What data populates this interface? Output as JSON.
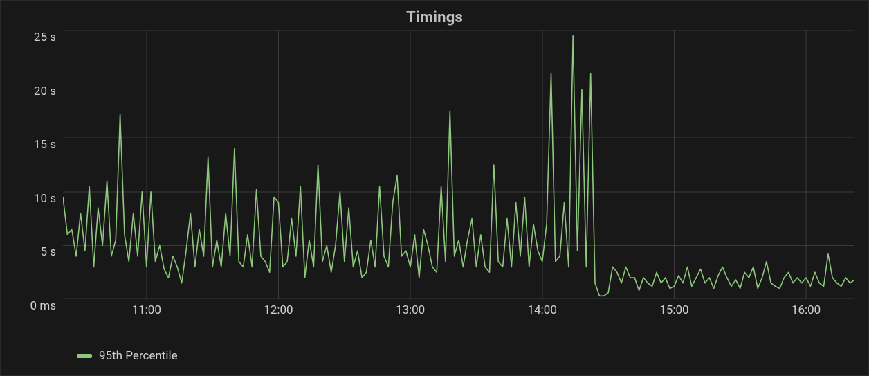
{
  "title": "Timings",
  "legend": {
    "series_label": "95th Percentile"
  },
  "colors": {
    "panel_bg": "#181818",
    "grid": "#3a3a3a",
    "line": "#8fc77e",
    "text": "#cfcfcf",
    "title": "#bfbfbf"
  },
  "y_axis": {
    "ticks": [
      {
        "value_sec": 0,
        "label": "0 ms"
      },
      {
        "value_sec": 5,
        "label": "5 s"
      },
      {
        "value_sec": 10,
        "label": "10 s"
      },
      {
        "value_sec": 15,
        "label": "15 s"
      },
      {
        "value_sec": 20,
        "label": "20 s"
      },
      {
        "value_sec": 25,
        "label": "25 s"
      }
    ],
    "ylim_sec": [
      0,
      25
    ]
  },
  "x_axis": {
    "ticks": [
      {
        "minute": 660,
        "label": "11:00"
      },
      {
        "minute": 720,
        "label": "12:00"
      },
      {
        "minute": 780,
        "label": "13:00"
      },
      {
        "minute": 840,
        "label": "14:00"
      },
      {
        "minute": 900,
        "label": "15:00"
      },
      {
        "minute": 960,
        "label": "16:00"
      }
    ],
    "xlim_minute": [
      622,
      982
    ]
  },
  "chart_data": {
    "type": "line",
    "title": "Timings",
    "xlabel": "",
    "ylabel": "",
    "x_unit": "minute_of_day",
    "y_unit": "seconds",
    "ylim": [
      0,
      25
    ],
    "xlim_minute": [
      622,
      982
    ],
    "x_tick_labels": [
      "11:00",
      "12:00",
      "13:00",
      "14:00",
      "15:00",
      "16:00"
    ],
    "y_tick_labels": [
      "0 ms",
      "5 s",
      "10 s",
      "15 s",
      "20 s",
      "25 s"
    ],
    "legend_position": "bottom-left",
    "grid": true,
    "series": [
      {
        "name": "95th Percentile",
        "color": "#8fc77e",
        "x": [
          622,
          624,
          626,
          628,
          630,
          632,
          634,
          636,
          638,
          640,
          642,
          644,
          646,
          648,
          650,
          652,
          654,
          656,
          658,
          660,
          662,
          664,
          666,
          668,
          670,
          672,
          674,
          676,
          678,
          680,
          682,
          684,
          686,
          688,
          690,
          692,
          694,
          696,
          698,
          700,
          702,
          704,
          706,
          708,
          710,
          712,
          714,
          716,
          718,
          720,
          722,
          724,
          726,
          728,
          730,
          732,
          734,
          736,
          738,
          740,
          742,
          744,
          746,
          748,
          750,
          752,
          754,
          756,
          758,
          760,
          762,
          764,
          766,
          768,
          770,
          772,
          774,
          776,
          778,
          780,
          782,
          784,
          786,
          788,
          790,
          792,
          794,
          796,
          798,
          800,
          802,
          804,
          806,
          808,
          810,
          812,
          814,
          816,
          818,
          820,
          822,
          824,
          826,
          828,
          830,
          832,
          834,
          836,
          838,
          840,
          842,
          844,
          846,
          848,
          850,
          852,
          854,
          856,
          858,
          860,
          862,
          864,
          866,
          868,
          870,
          872,
          874,
          876,
          878,
          880,
          882,
          884,
          886,
          888,
          890,
          892,
          894,
          896,
          898,
          900,
          902,
          904,
          906,
          908,
          910,
          912,
          914,
          916,
          918,
          920,
          922,
          924,
          926,
          928,
          930,
          932,
          934,
          936,
          938,
          940,
          942,
          944,
          946,
          948,
          950,
          952,
          954,
          956,
          958,
          960,
          962,
          964,
          966,
          968,
          970,
          972,
          974,
          976,
          978,
          980,
          982
        ],
        "values": [
          9.5,
          6.0,
          6.5,
          4.0,
          8.0,
          4.5,
          10.5,
          3.0,
          8.5,
          5.0,
          11.0,
          4.0,
          5.5,
          17.2,
          6.0,
          3.5,
          8.0,
          4.0,
          10.0,
          3.0,
          10.0,
          3.5,
          5.0,
          2.8,
          2.0,
          4.0,
          3.0,
          1.5,
          4.5,
          8.0,
          3.0,
          6.5,
          4.0,
          13.2,
          3.0,
          5.5,
          3.0,
          8.0,
          4.0,
          14.0,
          3.5,
          3.0,
          6.0,
          3.0,
          10.2,
          4.0,
          3.5,
          2.5,
          9.5,
          9.0,
          3.0,
          3.5,
          7.5,
          4.0,
          10.5,
          2.0,
          5.5,
          3.0,
          12.5,
          3.5,
          5.0,
          2.5,
          5.0,
          10.0,
          3.5,
          8.5,
          3.0,
          4.5,
          2.0,
          2.5,
          5.5,
          3.0,
          10.5,
          4.0,
          3.0,
          9.0,
          11.5,
          4.0,
          4.5,
          3.0,
          6.0,
          2.0,
          6.5,
          5.0,
          3.0,
          2.5,
          10.5,
          3.5,
          17.5,
          4.0,
          5.5,
          3.0,
          5.5,
          7.5,
          3.0,
          6.0,
          3.0,
          2.5,
          12.5,
          3.5,
          3.0,
          7.5,
          3.0,
          9.0,
          4.0,
          9.5,
          3.0,
          7.0,
          4.5,
          3.5,
          7.0,
          21.0,
          3.5,
          4.0,
          9.0,
          3.0,
          24.5,
          4.5,
          19.5,
          3.0,
          21.0,
          1.5,
          0.3,
          0.3,
          0.6,
          3.0,
          2.5,
          1.5,
          3.0,
          2.0,
          2.0,
          0.8,
          2.0,
          1.5,
          1.2,
          2.5,
          1.5,
          2.0,
          1.0,
          1.2,
          2.2,
          1.5,
          3.0,
          1.2,
          2.0,
          2.8,
          1.5,
          2.0,
          1.0,
          2.2,
          3.0,
          2.0,
          1.2,
          1.8,
          1.0,
          2.5,
          2.0,
          3.0,
          1.0,
          2.0,
          3.5,
          1.5,
          1.2,
          1.0,
          2.0,
          2.5,
          1.5,
          2.0,
          1.5,
          2.0,
          1.2,
          2.5,
          1.5,
          1.2,
          4.2,
          2.0,
          1.5,
          1.2,
          2.0,
          1.5,
          1.8
        ]
      }
    ]
  }
}
